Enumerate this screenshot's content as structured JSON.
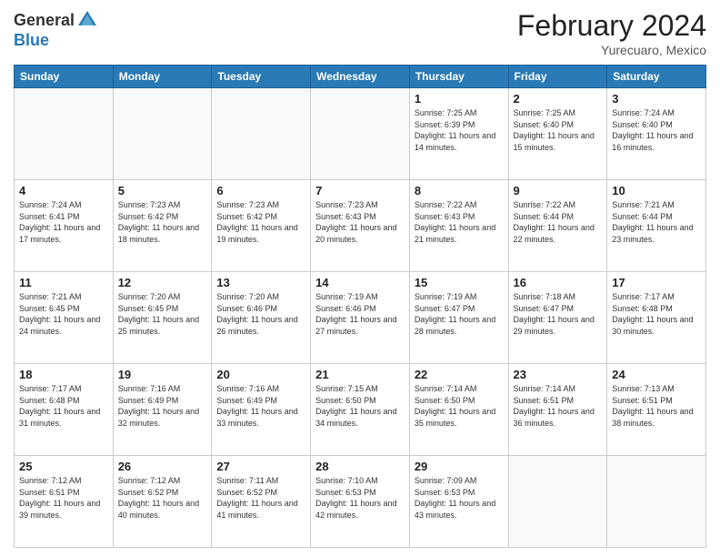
{
  "header": {
    "logo_general": "General",
    "logo_blue": "Blue",
    "month_year": "February 2024",
    "location": "Yurecuaro, Mexico"
  },
  "days_of_week": [
    "Sunday",
    "Monday",
    "Tuesday",
    "Wednesday",
    "Thursday",
    "Friday",
    "Saturday"
  ],
  "weeks": [
    [
      {
        "day": "",
        "sunrise": "",
        "sunset": "",
        "daylight": ""
      },
      {
        "day": "",
        "sunrise": "",
        "sunset": "",
        "daylight": ""
      },
      {
        "day": "",
        "sunrise": "",
        "sunset": "",
        "daylight": ""
      },
      {
        "day": "",
        "sunrise": "",
        "sunset": "",
        "daylight": ""
      },
      {
        "day": "1",
        "sunrise": "7:25 AM",
        "sunset": "6:39 PM",
        "daylight": "11 hours and 14 minutes."
      },
      {
        "day": "2",
        "sunrise": "7:25 AM",
        "sunset": "6:40 PM",
        "daylight": "11 hours and 15 minutes."
      },
      {
        "day": "3",
        "sunrise": "7:24 AM",
        "sunset": "6:40 PM",
        "daylight": "11 hours and 16 minutes."
      }
    ],
    [
      {
        "day": "4",
        "sunrise": "7:24 AM",
        "sunset": "6:41 PM",
        "daylight": "11 hours and 17 minutes."
      },
      {
        "day": "5",
        "sunrise": "7:23 AM",
        "sunset": "6:42 PM",
        "daylight": "11 hours and 18 minutes."
      },
      {
        "day": "6",
        "sunrise": "7:23 AM",
        "sunset": "6:42 PM",
        "daylight": "11 hours and 19 minutes."
      },
      {
        "day": "7",
        "sunrise": "7:23 AM",
        "sunset": "6:43 PM",
        "daylight": "11 hours and 20 minutes."
      },
      {
        "day": "8",
        "sunrise": "7:22 AM",
        "sunset": "6:43 PM",
        "daylight": "11 hours and 21 minutes."
      },
      {
        "day": "9",
        "sunrise": "7:22 AM",
        "sunset": "6:44 PM",
        "daylight": "11 hours and 22 minutes."
      },
      {
        "day": "10",
        "sunrise": "7:21 AM",
        "sunset": "6:44 PM",
        "daylight": "11 hours and 23 minutes."
      }
    ],
    [
      {
        "day": "11",
        "sunrise": "7:21 AM",
        "sunset": "6:45 PM",
        "daylight": "11 hours and 24 minutes."
      },
      {
        "day": "12",
        "sunrise": "7:20 AM",
        "sunset": "6:45 PM",
        "daylight": "11 hours and 25 minutes."
      },
      {
        "day": "13",
        "sunrise": "7:20 AM",
        "sunset": "6:46 PM",
        "daylight": "11 hours and 26 minutes."
      },
      {
        "day": "14",
        "sunrise": "7:19 AM",
        "sunset": "6:46 PM",
        "daylight": "11 hours and 27 minutes."
      },
      {
        "day": "15",
        "sunrise": "7:19 AM",
        "sunset": "6:47 PM",
        "daylight": "11 hours and 28 minutes."
      },
      {
        "day": "16",
        "sunrise": "7:18 AM",
        "sunset": "6:47 PM",
        "daylight": "11 hours and 29 minutes."
      },
      {
        "day": "17",
        "sunrise": "7:17 AM",
        "sunset": "6:48 PM",
        "daylight": "11 hours and 30 minutes."
      }
    ],
    [
      {
        "day": "18",
        "sunrise": "7:17 AM",
        "sunset": "6:48 PM",
        "daylight": "11 hours and 31 minutes."
      },
      {
        "day": "19",
        "sunrise": "7:16 AM",
        "sunset": "6:49 PM",
        "daylight": "11 hours and 32 minutes."
      },
      {
        "day": "20",
        "sunrise": "7:16 AM",
        "sunset": "6:49 PM",
        "daylight": "11 hours and 33 minutes."
      },
      {
        "day": "21",
        "sunrise": "7:15 AM",
        "sunset": "6:50 PM",
        "daylight": "11 hours and 34 minutes."
      },
      {
        "day": "22",
        "sunrise": "7:14 AM",
        "sunset": "6:50 PM",
        "daylight": "11 hours and 35 minutes."
      },
      {
        "day": "23",
        "sunrise": "7:14 AM",
        "sunset": "6:51 PM",
        "daylight": "11 hours and 36 minutes."
      },
      {
        "day": "24",
        "sunrise": "7:13 AM",
        "sunset": "6:51 PM",
        "daylight": "11 hours and 38 minutes."
      }
    ],
    [
      {
        "day": "25",
        "sunrise": "7:12 AM",
        "sunset": "6:51 PM",
        "daylight": "11 hours and 39 minutes."
      },
      {
        "day": "26",
        "sunrise": "7:12 AM",
        "sunset": "6:52 PM",
        "daylight": "11 hours and 40 minutes."
      },
      {
        "day": "27",
        "sunrise": "7:11 AM",
        "sunset": "6:52 PM",
        "daylight": "11 hours and 41 minutes."
      },
      {
        "day": "28",
        "sunrise": "7:10 AM",
        "sunset": "6:53 PM",
        "daylight": "11 hours and 42 minutes."
      },
      {
        "day": "29",
        "sunrise": "7:09 AM",
        "sunset": "6:53 PM",
        "daylight": "11 hours and 43 minutes."
      },
      {
        "day": "",
        "sunrise": "",
        "sunset": "",
        "daylight": ""
      },
      {
        "day": "",
        "sunrise": "",
        "sunset": "",
        "daylight": ""
      }
    ]
  ]
}
